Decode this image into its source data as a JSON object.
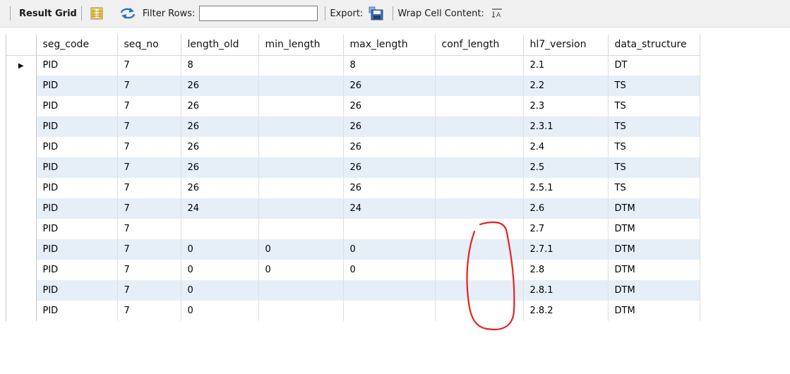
{
  "toolbar": {
    "result_grid_label": "Result Grid",
    "filter_rows_label": "Filter Rows:",
    "filter_value": "",
    "export_label": "Export:",
    "wrap_label": "Wrap Cell Content:",
    "icons": [
      "grid-layout-icon",
      "refresh-icon",
      "export-save-icon",
      "wrap-text-icon"
    ]
  },
  "table": {
    "columns": [
      "seg_code",
      "seq_no",
      "length_old",
      "min_length",
      "max_length",
      "conf_length",
      "hl7_version",
      "data_structure"
    ],
    "rows": [
      [
        "PID",
        "7",
        "8",
        "",
        "8",
        "",
        "2.1",
        "DT"
      ],
      [
        "PID",
        "7",
        "26",
        "",
        "26",
        "",
        "2.2",
        "TS"
      ],
      [
        "PID",
        "7",
        "26",
        "",
        "26",
        "",
        "2.3",
        "TS"
      ],
      [
        "PID",
        "7",
        "26",
        "",
        "26",
        "",
        "2.3.1",
        "TS"
      ],
      [
        "PID",
        "7",
        "26",
        "",
        "26",
        "",
        "2.4",
        "TS"
      ],
      [
        "PID",
        "7",
        "26",
        "",
        "26",
        "",
        "2.5",
        "TS"
      ],
      [
        "PID",
        "7",
        "26",
        "",
        "26",
        "",
        "2.5.1",
        "TS"
      ],
      [
        "PID",
        "7",
        "24",
        "",
        "24",
        "",
        "2.6",
        "DTM"
      ],
      [
        "PID",
        "7",
        "",
        "",
        "",
        "",
        "2.7",
        "DTM"
      ],
      [
        "PID",
        "7",
        "0",
        "0",
        "0",
        "",
        "2.7.1",
        "DTM"
      ],
      [
        "PID",
        "7",
        "0",
        "0",
        "0",
        "",
        "2.8",
        "DTM"
      ],
      [
        "PID",
        "7",
        "0",
        "",
        "",
        "",
        "2.8.1",
        "DTM"
      ],
      [
        "PID",
        "7",
        "0",
        "",
        "",
        "",
        "2.8.2",
        "DTM"
      ]
    ],
    "selected_row": 0,
    "row_indicator": "▶"
  },
  "annotation_color": "#e8231e",
  "colors": {
    "alt_row": "#e6eef8",
    "toolbar_bg": "#f0f0f0"
  }
}
